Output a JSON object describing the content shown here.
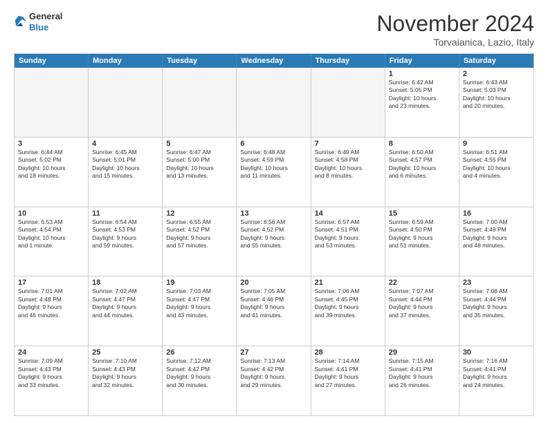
{
  "logo": {
    "general": "General",
    "blue": "Blue"
  },
  "title": "November 2024",
  "location": "Torvaianica, Lazio, Italy",
  "days_header": [
    "Sunday",
    "Monday",
    "Tuesday",
    "Wednesday",
    "Thursday",
    "Friday",
    "Saturday"
  ],
  "weeks": [
    [
      {
        "day": "",
        "info": ""
      },
      {
        "day": "",
        "info": ""
      },
      {
        "day": "",
        "info": ""
      },
      {
        "day": "",
        "info": ""
      },
      {
        "day": "",
        "info": ""
      },
      {
        "day": "1",
        "info": "Sunrise: 6:42 AM\nSunset: 5:05 PM\nDaylight: 10 hours\nand 23 minutes."
      },
      {
        "day": "2",
        "info": "Sunrise: 6:43 AM\nSunset: 5:03 PM\nDaylight: 10 hours\nand 20 minutes."
      }
    ],
    [
      {
        "day": "3",
        "info": "Sunrise: 6:44 AM\nSunset: 5:02 PM\nDaylight: 10 hours\nand 18 minutes."
      },
      {
        "day": "4",
        "info": "Sunrise: 6:45 AM\nSunset: 5:01 PM\nDaylight: 10 hours\nand 15 minutes."
      },
      {
        "day": "5",
        "info": "Sunrise: 6:47 AM\nSunset: 5:00 PM\nDaylight: 10 hours\nand 13 minutes."
      },
      {
        "day": "6",
        "info": "Sunrise: 6:48 AM\nSunset: 4:59 PM\nDaylight: 10 hours\nand 11 minutes."
      },
      {
        "day": "7",
        "info": "Sunrise: 6:49 AM\nSunset: 4:58 PM\nDaylight: 10 hours\nand 8 minutes."
      },
      {
        "day": "8",
        "info": "Sunrise: 6:50 AM\nSunset: 4:57 PM\nDaylight: 10 hours\nand 6 minutes."
      },
      {
        "day": "9",
        "info": "Sunrise: 6:51 AM\nSunset: 4:55 PM\nDaylight: 10 hours\nand 4 minutes."
      }
    ],
    [
      {
        "day": "10",
        "info": "Sunrise: 6:53 AM\nSunset: 4:54 PM\nDaylight: 10 hours\nand 1 minute."
      },
      {
        "day": "11",
        "info": "Sunrise: 6:54 AM\nSunset: 4:53 PM\nDaylight: 9 hours\nand 59 minutes."
      },
      {
        "day": "12",
        "info": "Sunrise: 6:55 AM\nSunset: 4:52 PM\nDaylight: 9 hours\nand 57 minutes."
      },
      {
        "day": "13",
        "info": "Sunrise: 6:56 AM\nSunset: 4:52 PM\nDaylight: 9 hours\nand 55 minutes."
      },
      {
        "day": "14",
        "info": "Sunrise: 6:57 AM\nSunset: 4:51 PM\nDaylight: 9 hours\nand 53 minutes."
      },
      {
        "day": "15",
        "info": "Sunrise: 6:59 AM\nSunset: 4:50 PM\nDaylight: 9 hours\nand 51 minutes."
      },
      {
        "day": "16",
        "info": "Sunrise: 7:00 AM\nSunset: 4:49 PM\nDaylight: 9 hours\nand 48 minutes."
      }
    ],
    [
      {
        "day": "17",
        "info": "Sunrise: 7:01 AM\nSunset: 4:48 PM\nDaylight: 9 hours\nand 46 minutes."
      },
      {
        "day": "18",
        "info": "Sunrise: 7:02 AM\nSunset: 4:47 PM\nDaylight: 9 hours\nand 44 minutes."
      },
      {
        "day": "19",
        "info": "Sunrise: 7:03 AM\nSunset: 4:47 PM\nDaylight: 9 hours\nand 43 minutes."
      },
      {
        "day": "20",
        "info": "Sunrise: 7:05 AM\nSunset: 4:46 PM\nDaylight: 9 hours\nand 41 minutes."
      },
      {
        "day": "21",
        "info": "Sunrise: 7:06 AM\nSunset: 4:45 PM\nDaylight: 9 hours\nand 39 minutes."
      },
      {
        "day": "22",
        "info": "Sunrise: 7:07 AM\nSunset: 4:44 PM\nDaylight: 9 hours\nand 37 minutes."
      },
      {
        "day": "23",
        "info": "Sunrise: 7:08 AM\nSunset: 4:44 PM\nDaylight: 9 hours\nand 35 minutes."
      }
    ],
    [
      {
        "day": "24",
        "info": "Sunrise: 7:09 AM\nSunset: 4:43 PM\nDaylight: 9 hours\nand 33 minutes."
      },
      {
        "day": "25",
        "info": "Sunrise: 7:10 AM\nSunset: 4:43 PM\nDaylight: 9 hours\nand 32 minutes."
      },
      {
        "day": "26",
        "info": "Sunrise: 7:12 AM\nSunset: 4:42 PM\nDaylight: 9 hours\nand 30 minutes."
      },
      {
        "day": "27",
        "info": "Sunrise: 7:13 AM\nSunset: 4:42 PM\nDaylight: 9 hours\nand 29 minutes."
      },
      {
        "day": "28",
        "info": "Sunrise: 7:14 AM\nSunset: 4:41 PM\nDaylight: 9 hours\nand 27 minutes."
      },
      {
        "day": "29",
        "info": "Sunrise: 7:15 AM\nSunset: 4:41 PM\nDaylight: 9 hours\nand 26 minutes."
      },
      {
        "day": "30",
        "info": "Sunrise: 7:16 AM\nSunset: 4:41 PM\nDaylight: 9 hours\nand 24 minutes."
      }
    ]
  ]
}
